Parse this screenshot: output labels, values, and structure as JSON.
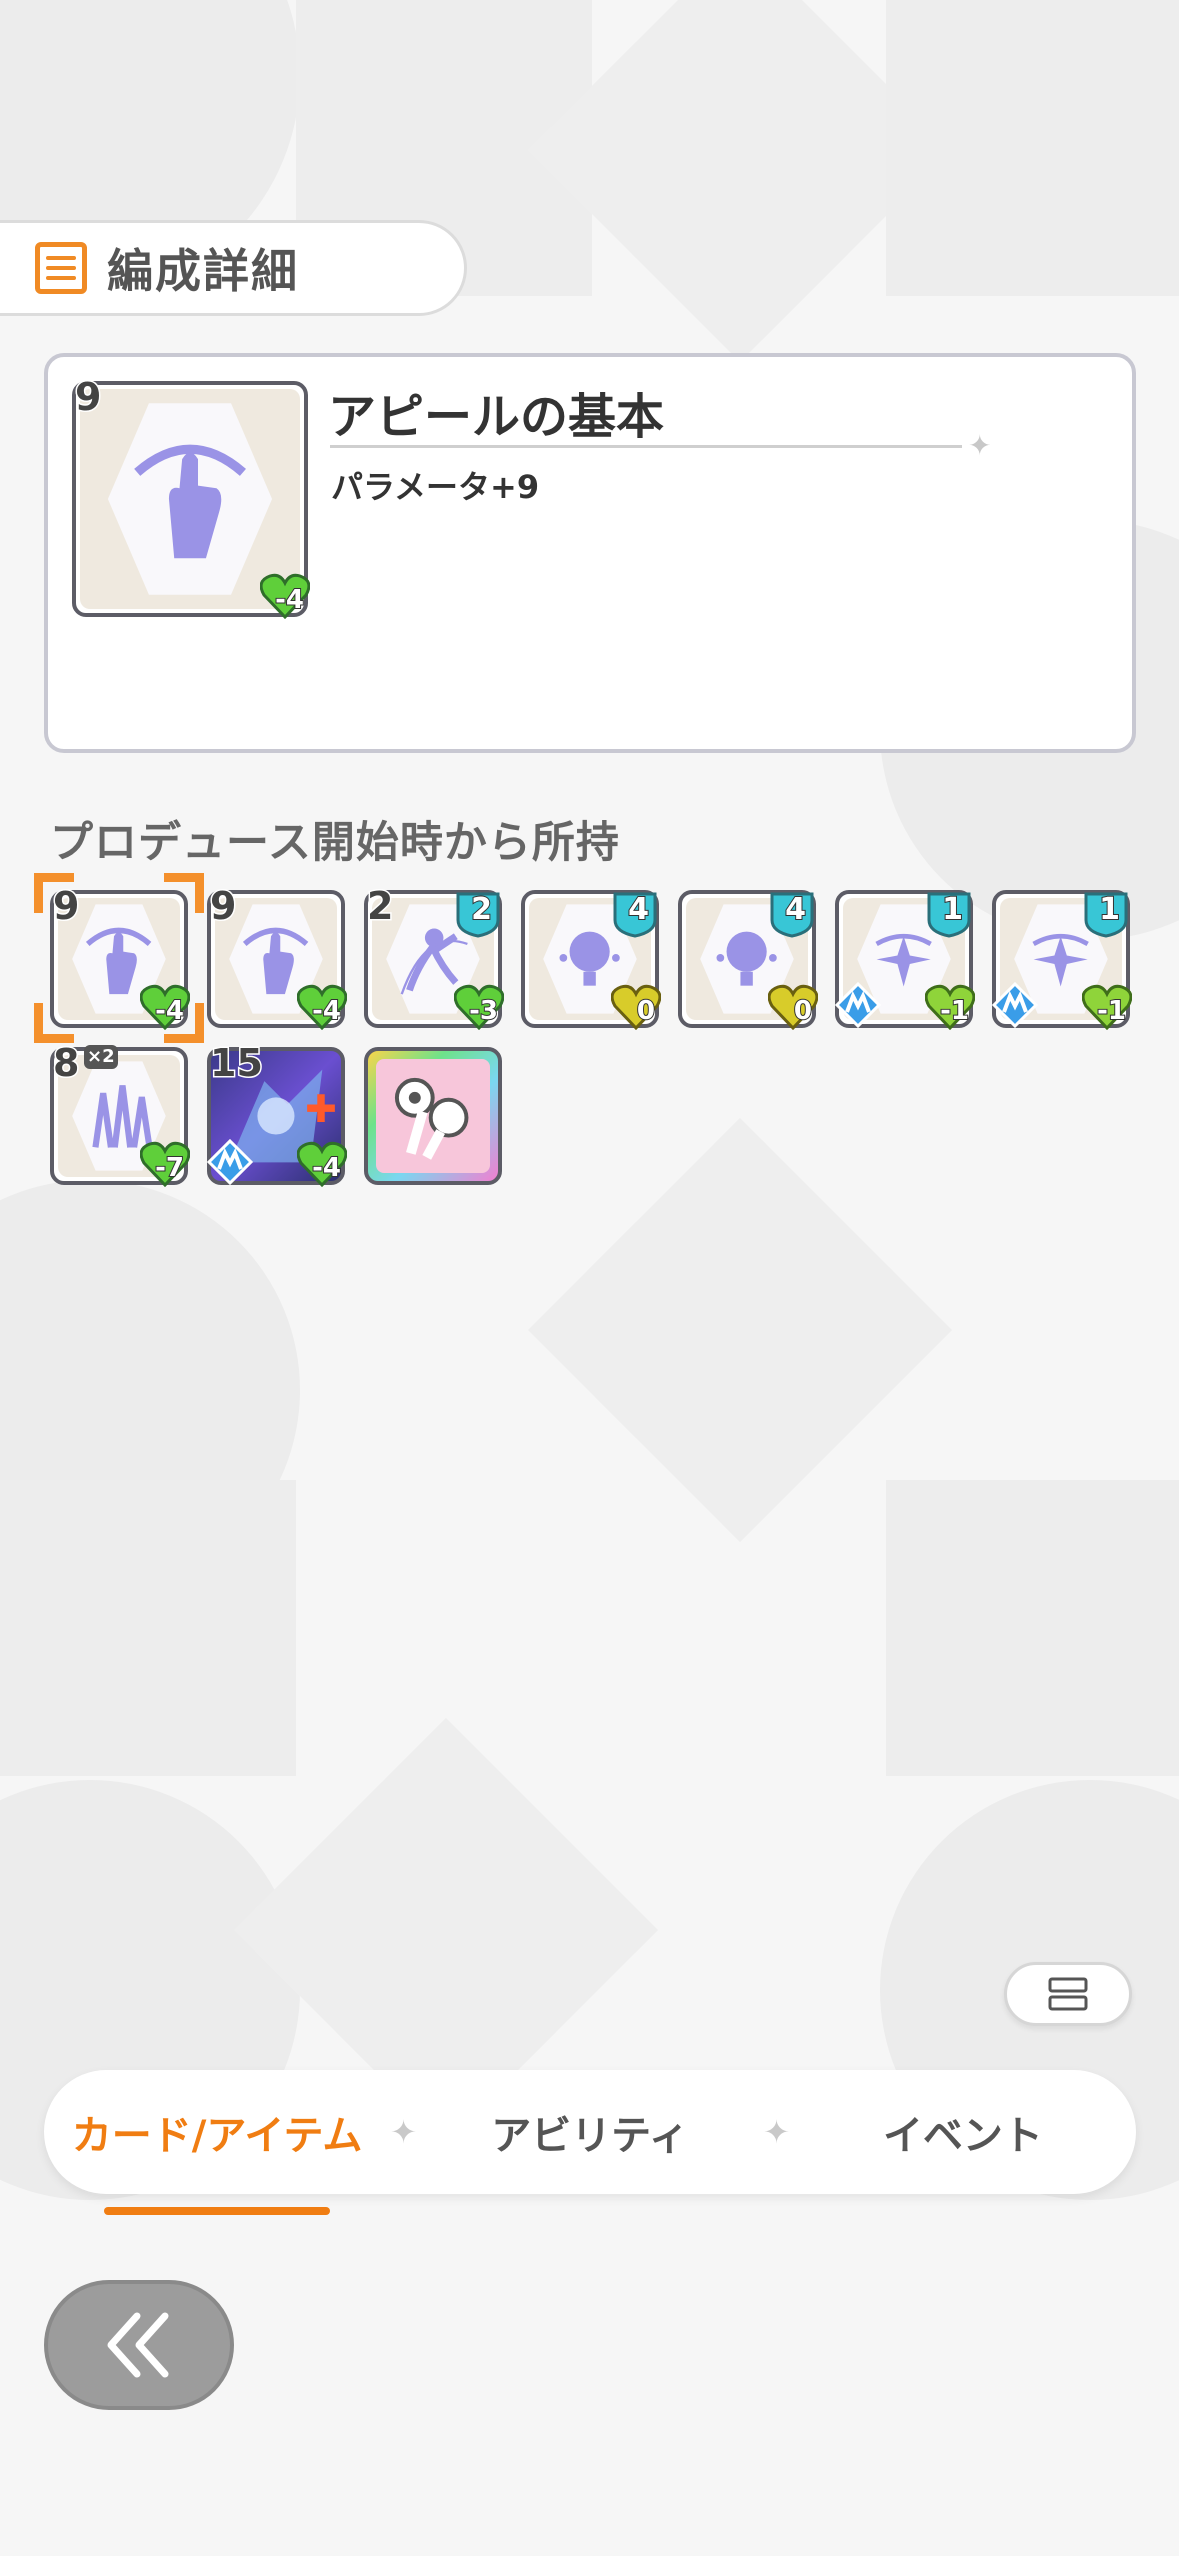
{
  "header": {
    "title": "編成詳細",
    "icon": "list-icon"
  },
  "detail": {
    "card_level": "9",
    "card_cost": "-4",
    "name": "アピールの基本",
    "description": "パラメータ+9"
  },
  "section_title": "プロデュース開始時から所持",
  "cards": [
    {
      "level": "9",
      "cost": "-4",
      "selected": true
    },
    {
      "level": "9",
      "cost": "-4"
    },
    {
      "level": "2",
      "badge": "2",
      "cost": "-3"
    },
    {
      "badge": "4",
      "cost": "0"
    },
    {
      "badge": "4",
      "cost": "0"
    },
    {
      "badge": "1",
      "cost": "-1"
    },
    {
      "badge": "1",
      "cost": "-1"
    },
    {
      "level": "8",
      "times": "×2",
      "cost": "-7"
    },
    {
      "level": "15",
      "cost": "-4"
    },
    {
      "type": "item"
    }
  ],
  "tabs": [
    {
      "label": "カード/アイテム",
      "active": true
    },
    {
      "label": "アビリティ"
    },
    {
      "label": "イベント"
    }
  ],
  "colors": {
    "accent": "#f07d12",
    "heart": "#5fcf3a",
    "shield": "#38c6d6",
    "art": "#9a93e6"
  }
}
